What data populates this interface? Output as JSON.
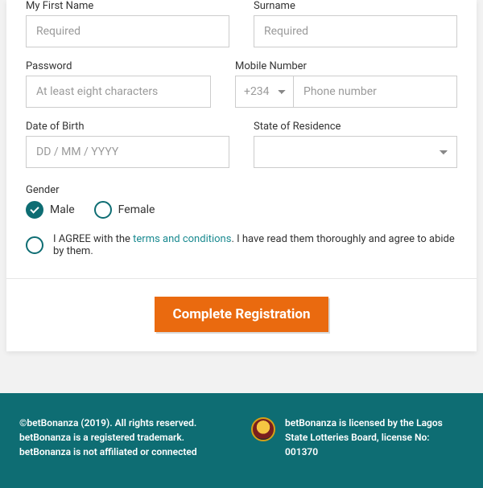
{
  "fields": {
    "first_name": {
      "label": "My First Name",
      "placeholder": "Required"
    },
    "surname": {
      "label": "Surname",
      "placeholder": "Required"
    },
    "password": {
      "label": "Password",
      "placeholder": "At least eight characters"
    },
    "mobile": {
      "label": "Mobile Number",
      "cc": "+234",
      "placeholder": "Phone number"
    },
    "dob": {
      "label": "Date of Birth",
      "placeholder": "DD / MM / YYYY"
    },
    "state": {
      "label": "State of Residence"
    },
    "gender": {
      "label": "Gender",
      "male": "Male",
      "female": "Female"
    }
  },
  "agree": {
    "pre": "I AGREE with the ",
    "link": "terms and conditions",
    "post": ". I have read them thoroughly and agree to abide by them."
  },
  "submit": "Complete Registration",
  "footer": {
    "left": "©betBonanza (2019). All rights reserved. betBonanza is a registered trademark. betBonanza is not affiliated or connected",
    "right": "betBonanza is licensed by the Lagos State Lotteries Board, license No: 001370"
  }
}
